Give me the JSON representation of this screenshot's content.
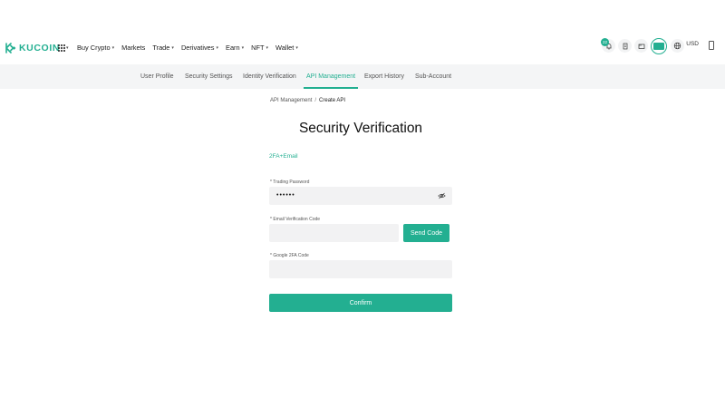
{
  "brand": {
    "name": "KUCOIN",
    "color": "#23af91"
  },
  "nav": {
    "menu": [
      {
        "label": "Buy Crypto",
        "dropdown": true
      },
      {
        "label": "Markets",
        "dropdown": false
      },
      {
        "label": "Trade",
        "dropdown": true
      },
      {
        "label": "Derivatives",
        "dropdown": true
      },
      {
        "label": "Earn",
        "dropdown": true
      },
      {
        "label": "NFT",
        "dropdown": true
      },
      {
        "label": "Wallet",
        "dropdown": true
      }
    ],
    "notification_count": "22",
    "currency": "USD",
    "icons": [
      "apps-grid-icon",
      "bell-icon",
      "document-icon",
      "wallet-icon",
      "avatar-icon",
      "globe-icon",
      "phone-icon"
    ]
  },
  "tabs": [
    {
      "label": "User Profile",
      "active": false
    },
    {
      "label": "Security Settings",
      "active": false
    },
    {
      "label": "Identity Verification",
      "active": false
    },
    {
      "label": "API Management",
      "active": true
    },
    {
      "label": "Export History",
      "active": false
    },
    {
      "label": "Sub-Account",
      "active": false
    }
  ],
  "breadcrumb": {
    "parent": "API Management",
    "separator": "/",
    "current": "Create API"
  },
  "form": {
    "title": "Security Verification",
    "method": "2FA+Email",
    "trading_password": {
      "label": "Trading Password",
      "value": "••••••"
    },
    "email_code": {
      "label": "Email Verification Code",
      "value": "",
      "button": "Send Code"
    },
    "google_2fa": {
      "label": "Google 2FA Code",
      "value": ""
    },
    "required_mark": "*",
    "confirm": "Confirm"
  }
}
